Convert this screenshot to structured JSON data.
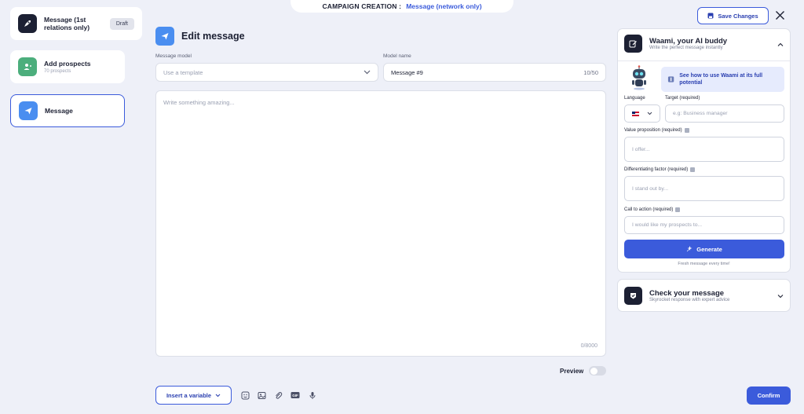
{
  "banner": {
    "label": "CAMPAIGN CREATION :",
    "value": "Message (network only)"
  },
  "sidebar": {
    "steps": [
      {
        "title": "Message (1st relations only)",
        "badge": "Draft"
      },
      {
        "title": "Add prospects",
        "subtitle": "70 prospects"
      },
      {
        "title": "Message"
      }
    ]
  },
  "editor": {
    "title": "Edit message",
    "model_label": "Message model",
    "model_placeholder": "Use a template",
    "name_label": "Model name",
    "name_value": "Message #9",
    "name_count": "10/50",
    "message_placeholder": "Write something amazing...",
    "message_count": "0/8000",
    "preview_label": "Preview",
    "insert_variable": "Insert a variable",
    "confirm": "Confirm"
  },
  "header": {
    "save_changes": "Save Changes"
  },
  "ai_panel": {
    "title": "Waami, your AI buddy",
    "subtitle": "Write the perfect message instantly",
    "link": "See how to use Waami at its full potential",
    "language_label": "Language",
    "target_label": "Target (required)",
    "target_placeholder": "e.g: Business manager",
    "value_label": "Value proposition (required)",
    "value_placeholder": "I offer...",
    "diff_label": "Differentiating factor (required)",
    "diff_placeholder": "I stand out by...",
    "cta_label": "Call to action (required)",
    "cta_placeholder": "I would like my prospects to...",
    "generate": "Generate",
    "fresh_note": "Fresh message every time!"
  },
  "check_panel": {
    "title": "Check your message",
    "subtitle": "Skyrocket response with expert advice"
  },
  "colors": {
    "accent": "#3b5bdb",
    "background": "#eef0f8",
    "dark": "#1c2033",
    "green": "#4cae7c",
    "blue_icon": "#4a8ef0"
  }
}
